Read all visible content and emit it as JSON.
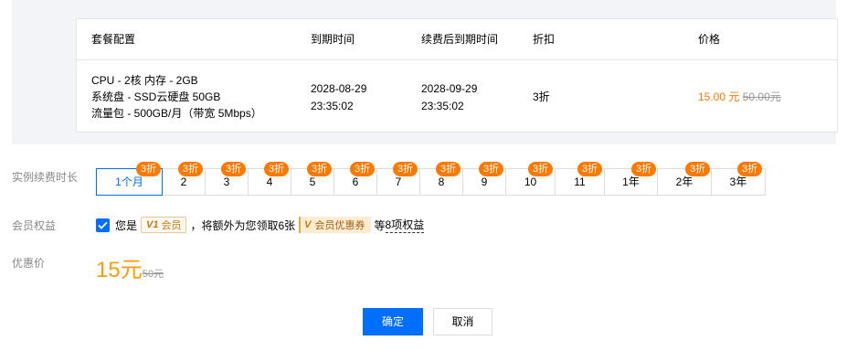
{
  "table": {
    "headers": [
      "套餐配置",
      "到期时间",
      "续费后到期时间",
      "折扣",
      "价格"
    ],
    "row": {
      "spec": [
        "CPU - 2核 内存 - 2GB",
        "系统盘 - SSD云硬盘 50GB",
        "流量包 - 500GB/月（带宽 5Mbps）"
      ],
      "expire_date": "2028-08-29",
      "expire_time": "23:35:02",
      "renew_date": "2028-09-29",
      "renew_time": "23:35:02",
      "discount": "3折",
      "price_now": "15.00 元",
      "price_old": "50.00元"
    }
  },
  "duration": {
    "label": "实例续费时长",
    "options": [
      {
        "label": "1个月",
        "badge": "3折",
        "selected": true
      },
      {
        "label": "2",
        "badge": "3折"
      },
      {
        "label": "3",
        "badge": "3折"
      },
      {
        "label": "4",
        "badge": "3折"
      },
      {
        "label": "5",
        "badge": "3折"
      },
      {
        "label": "6",
        "badge": "3折"
      },
      {
        "label": "7",
        "badge": "3折"
      },
      {
        "label": "8",
        "badge": "3折"
      },
      {
        "label": "9",
        "badge": "3折"
      },
      {
        "label": "10",
        "badge": "3折"
      },
      {
        "label": "11",
        "badge": "3折"
      },
      {
        "label": "1年",
        "badge": "3折"
      },
      {
        "label": "2年",
        "badge": "3折"
      },
      {
        "label": "3年",
        "badge": "3折"
      }
    ]
  },
  "member": {
    "label": "会员权益",
    "checked": true,
    "text_prefix": "您是",
    "v1_mark": "V1",
    "v1_text": "会员",
    "text_middle": "，将额外为您领取6张",
    "coupon_mark": "V",
    "coupon_text": "会员优惠券",
    "text_suffix": "等",
    "rights_link": "8项权益"
  },
  "promo": {
    "label": "优惠价",
    "price": "15元",
    "old_price": "50元"
  },
  "buttons": {
    "confirm": "确定",
    "cancel": "取消"
  },
  "colors": {
    "accent": "#006eff",
    "badge": "#ff7800",
    "price": "#ff9c00"
  }
}
